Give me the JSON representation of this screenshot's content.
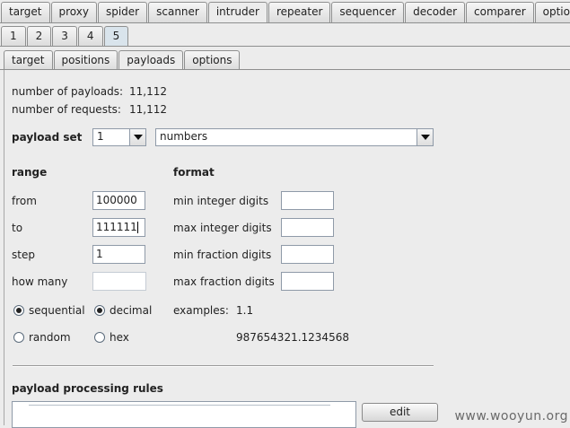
{
  "main_tabs": [
    "target",
    "proxy",
    "spider",
    "scanner",
    "intruder",
    "repeater",
    "sequencer",
    "decoder",
    "comparer",
    "options"
  ],
  "main_selected": "intruder",
  "attack_tabs": [
    "1",
    "2",
    "3",
    "4",
    "5"
  ],
  "attack_selected": "5",
  "sub_tabs": [
    "target",
    "positions",
    "payloads",
    "options"
  ],
  "sub_selected": "payloads",
  "summary": {
    "payloads_label": "number of payloads:",
    "payloads_value": "11,112",
    "requests_label": "number of requests:",
    "requests_value": "11,112"
  },
  "payload_set": {
    "label": "payload set",
    "set_value": "1",
    "type_value": "numbers"
  },
  "range": {
    "heading": "range",
    "from_label": "from",
    "from_value": "100000",
    "to_label": "to",
    "to_value": "111111",
    "step_label": "step",
    "step_value": "1",
    "howmany_label": "how many",
    "howmany_value": ""
  },
  "format": {
    "heading": "format",
    "min_int_label": "min integer digits",
    "max_int_label": "max integer digits",
    "min_frac_label": "min fraction digits",
    "max_frac_label": "max fraction digits"
  },
  "options": {
    "sequential": "sequential",
    "random": "random",
    "decimal": "decimal",
    "hex": "hex",
    "sequential_selected": true,
    "decimal_selected": true
  },
  "examples": {
    "label": "examples:",
    "example1": "1.1",
    "example2": "987654321.1234568"
  },
  "processing": {
    "heading": "payload processing rules",
    "edit_label": "edit"
  },
  "watermark": "www.wooyun.org"
}
